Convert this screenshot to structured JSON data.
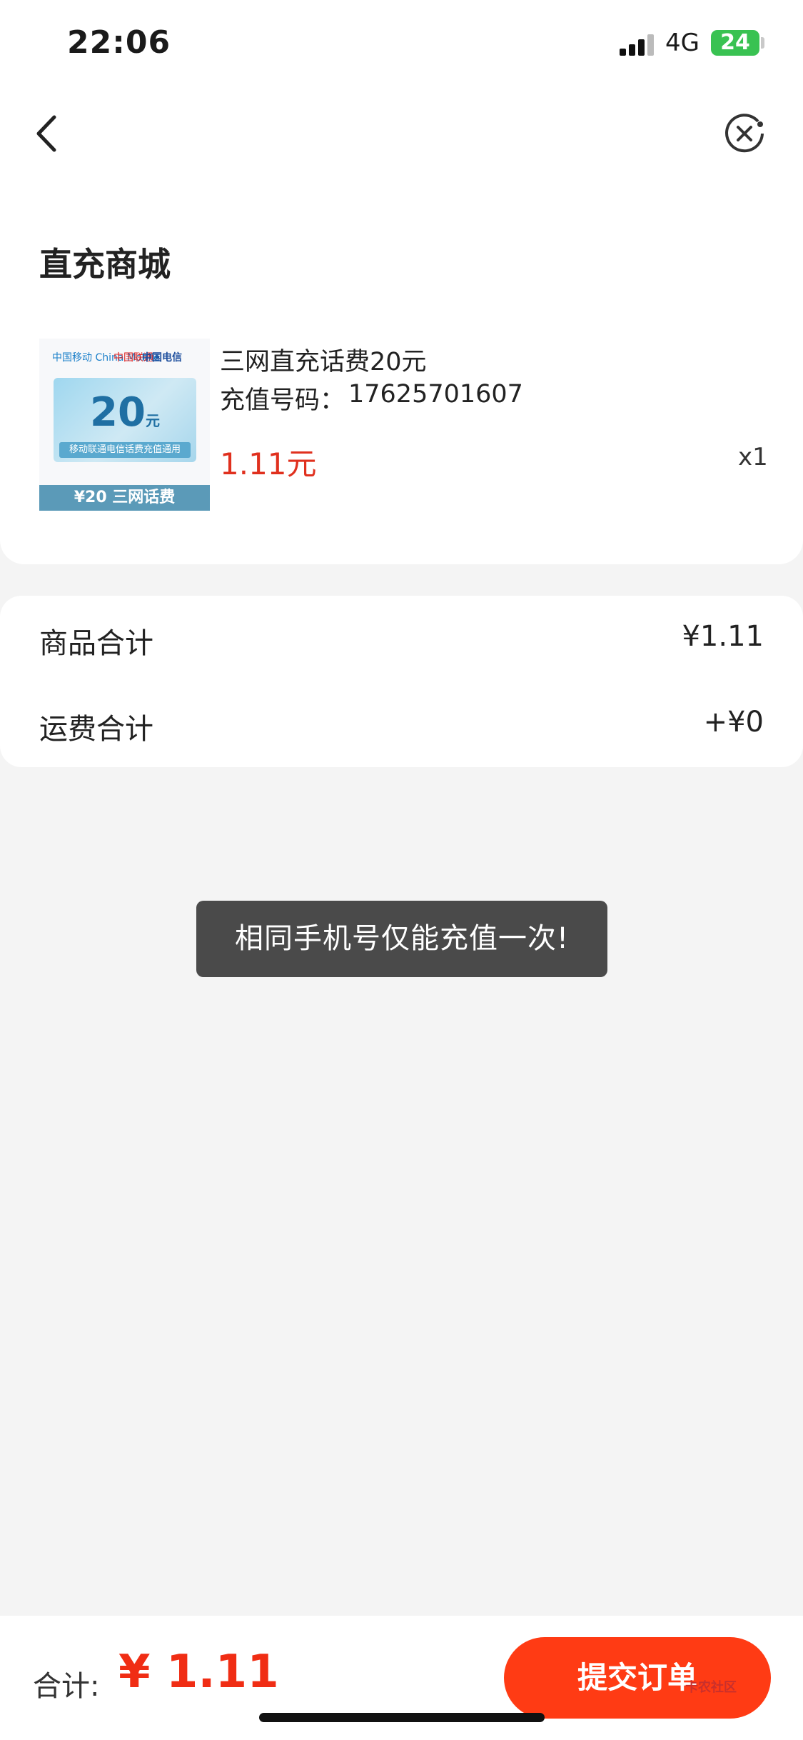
{
  "status_bar": {
    "time": "22:06",
    "network": "4G",
    "battery": "24"
  },
  "shop": {
    "title": "直充商城"
  },
  "product": {
    "thumb_logos": [
      "中国移动 China Mobile",
      "中国联通",
      "中国电信"
    ],
    "thumb_value": "20",
    "thumb_unit": "元",
    "thumb_sub": "移动联通电信话费充值通用",
    "thumb_footer": "¥20 三网话费",
    "name": "三网直充话费20元",
    "phone_label": "充值号码：",
    "phone": "17625701607",
    "price": "1.11元",
    "qty": "x1"
  },
  "totals": {
    "goods_label": "商品合计",
    "goods_value": "¥1.11",
    "shipping_label": "运费合计",
    "shipping_value": "+¥0"
  },
  "toast": {
    "text": "相同手机号仅能充值一次!"
  },
  "footer": {
    "total_label": "合计:",
    "total_value": "¥ 1.11",
    "submit_label": "提交订单",
    "watermark": "卡农社区"
  },
  "colors": {
    "accent": "#ff3b14",
    "price": "#e0301e"
  }
}
